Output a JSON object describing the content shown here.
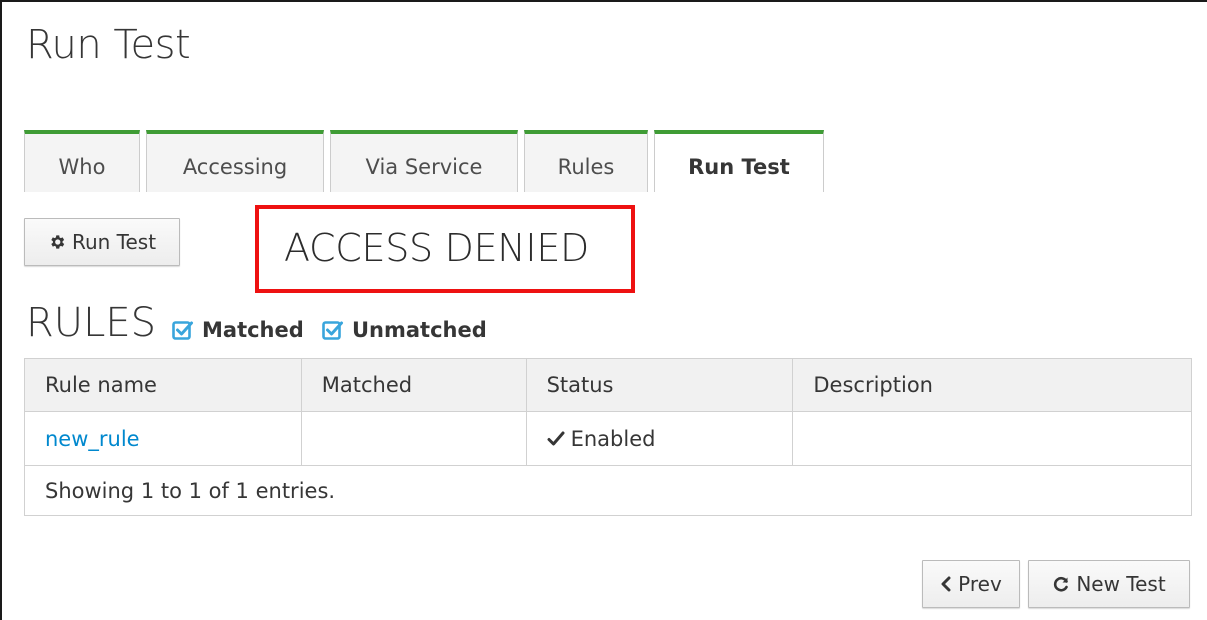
{
  "page": {
    "title": "Run Test"
  },
  "tabs": [
    {
      "label": "Who"
    },
    {
      "label": "Accessing"
    },
    {
      "label": "Via Service"
    },
    {
      "label": "Rules"
    },
    {
      "label": "Run Test",
      "active": true
    }
  ],
  "toolbar": {
    "run_test_label": "Run Test",
    "run_test_icon": "gear-icon"
  },
  "result": {
    "text": "ACCESS DENIED",
    "highlight_color": "#ee1111"
  },
  "rules": {
    "heading": "RULES",
    "filters": [
      {
        "label": "Matched",
        "checked": true
      },
      {
        "label": "Unmatched",
        "checked": true
      }
    ],
    "columns": [
      "Rule name",
      "Matched",
      "Status",
      "Description"
    ],
    "rows": [
      {
        "rule_name": "new_rule",
        "matched": "",
        "status": "Enabled",
        "status_icon": "check-icon",
        "description": ""
      }
    ],
    "footer": "Showing 1 to 1 of 1 entries."
  },
  "nav": {
    "prev_label": "Prev",
    "prev_icon": "chevron-left-icon",
    "new_test_label": "New Test",
    "new_test_icon": "refresh-icon"
  },
  "colors": {
    "tab_accent": "#3f9c35",
    "link": "#0088ce",
    "checkbox": "#39a5dc"
  }
}
